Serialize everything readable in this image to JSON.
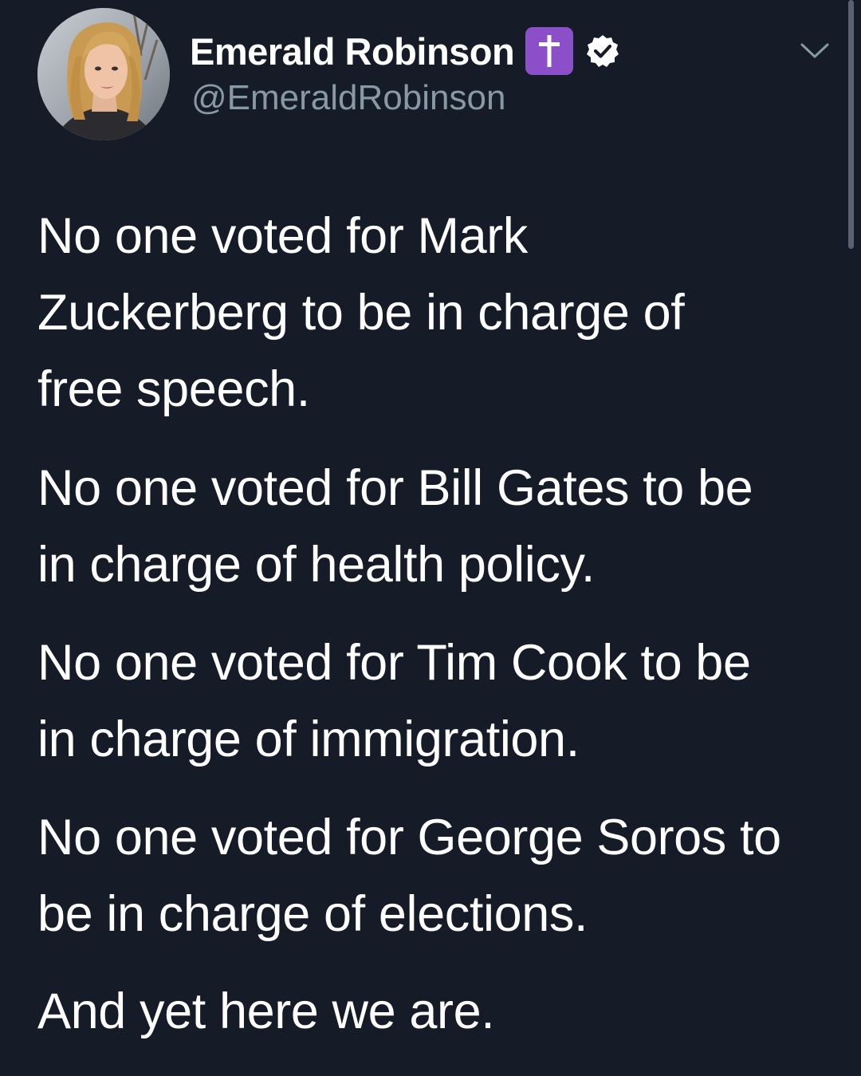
{
  "tweet": {
    "display_name": "Emerald Robinson",
    "handle": "@EmeraldRobinson",
    "badges": [
      "latin-cross-emoji",
      "verified-icon"
    ],
    "menu_icon": "chevron-down-icon",
    "paragraphs": [
      "No one voted for Mark\nZuckerberg to be in charge of\nfree speech.",
      "No one voted for Bill Gates to be\nin charge of health policy.",
      "No one voted for Tim Cook to be\nin charge of immigration.",
      "No one voted for George Soros to\nbe in charge of elections.",
      "And yet here we are."
    ]
  },
  "colors": {
    "background": "#151c28",
    "text": "#ffffff",
    "secondary_text": "#8899a6",
    "cross_badge": "#8b4fc8"
  }
}
